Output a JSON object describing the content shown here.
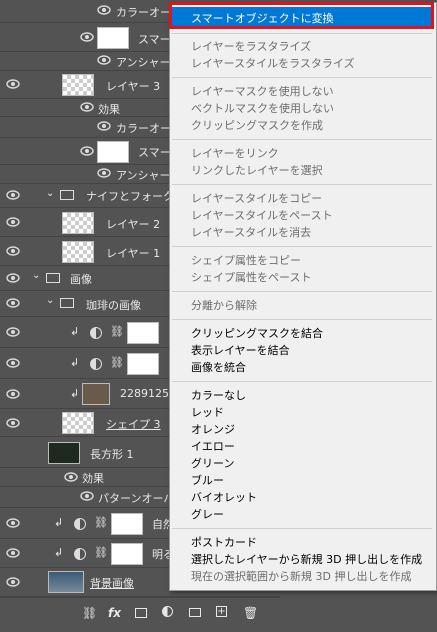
{
  "layers": [
    {
      "name": "カラーオー",
      "type": "fx"
    },
    {
      "name": "スマー",
      "type": "smartfilter"
    },
    {
      "name": "アンシャープ",
      "type": "fx"
    },
    {
      "name": "レイヤー 3",
      "type": "layer"
    },
    {
      "name": "効果",
      "type": "fx"
    },
    {
      "name": "カラーオーバ",
      "type": "fx"
    },
    {
      "name": "スマー",
      "type": "smartfilter"
    },
    {
      "name": "アンシャープ",
      "type": "fx"
    },
    {
      "name": "ナイフとフォークの",
      "type": "group"
    },
    {
      "name": "レイヤー 2",
      "type": "layer"
    },
    {
      "name": "レイヤー 1",
      "type": "layer"
    },
    {
      "name": "画像",
      "type": "group"
    },
    {
      "name": "珈琲の画像",
      "type": "group"
    },
    {
      "name": "",
      "type": "adjust"
    },
    {
      "name": "",
      "type": "adjust"
    },
    {
      "name": "22891251",
      "type": "layer"
    },
    {
      "name": "シェイプ 3",
      "type": "shape"
    },
    {
      "name": "長方形 1",
      "type": "shape"
    },
    {
      "name": "効果",
      "type": "fx"
    },
    {
      "name": "パターンオーバ",
      "type": "fx"
    },
    {
      "name": "自然",
      "type": "adjust"
    },
    {
      "name": "明る",
      "type": "adjust"
    },
    {
      "name": "背景画像",
      "type": "layer"
    }
  ],
  "menu": {
    "items": [
      {
        "label": "スマートオブジェクトに変換",
        "enabled": true,
        "highlighted": true
      },
      {
        "label": "レイヤーをラスタライズ",
        "enabled": false
      },
      {
        "label": "レイヤースタイルをラスタライズ",
        "enabled": false
      },
      {
        "label": "レイヤーマスクを使用しない",
        "enabled": false
      },
      {
        "label": "ベクトルマスクを使用しない",
        "enabled": false
      },
      {
        "label": "クリッピングマスクを作成",
        "enabled": false
      },
      {
        "label": "レイヤーをリンク",
        "enabled": false
      },
      {
        "label": "リンクしたレイヤーを選択",
        "enabled": false
      },
      {
        "label": "レイヤースタイルをコピー",
        "enabled": false
      },
      {
        "label": "レイヤースタイルをペースト",
        "enabled": false
      },
      {
        "label": "レイヤースタイルを消去",
        "enabled": false
      },
      {
        "label": "シェイプ属性をコピー",
        "enabled": false
      },
      {
        "label": "シェイプ属性をペースト",
        "enabled": false
      },
      {
        "label": "分離から解除",
        "enabled": false
      },
      {
        "label": "クリッピングマスクを結合",
        "enabled": true
      },
      {
        "label": "表示レイヤーを結合",
        "enabled": true
      },
      {
        "label": "画像を統合",
        "enabled": true
      },
      {
        "label": "カラーなし",
        "enabled": true
      },
      {
        "label": "レッド",
        "enabled": true
      },
      {
        "label": "オレンジ",
        "enabled": true
      },
      {
        "label": "イエロー",
        "enabled": true
      },
      {
        "label": "グリーン",
        "enabled": true
      },
      {
        "label": "ブルー",
        "enabled": true
      },
      {
        "label": "バイオレット",
        "enabled": true
      },
      {
        "label": "グレー",
        "enabled": true
      },
      {
        "label": "ポストカード",
        "enabled": true
      },
      {
        "label": "選択したレイヤーから新規 3D 押し出しを作成",
        "enabled": true
      },
      {
        "label": "現在の選択範囲から新規 3D 押し出しを作成",
        "enabled": false
      }
    ]
  },
  "bottom_bar": {
    "fx_label": "fx"
  },
  "colors": {
    "panel_bg": "#535353",
    "menu_bg": "#f0f0f0",
    "highlight": "#0078d7",
    "red_box": "#e0141e"
  }
}
